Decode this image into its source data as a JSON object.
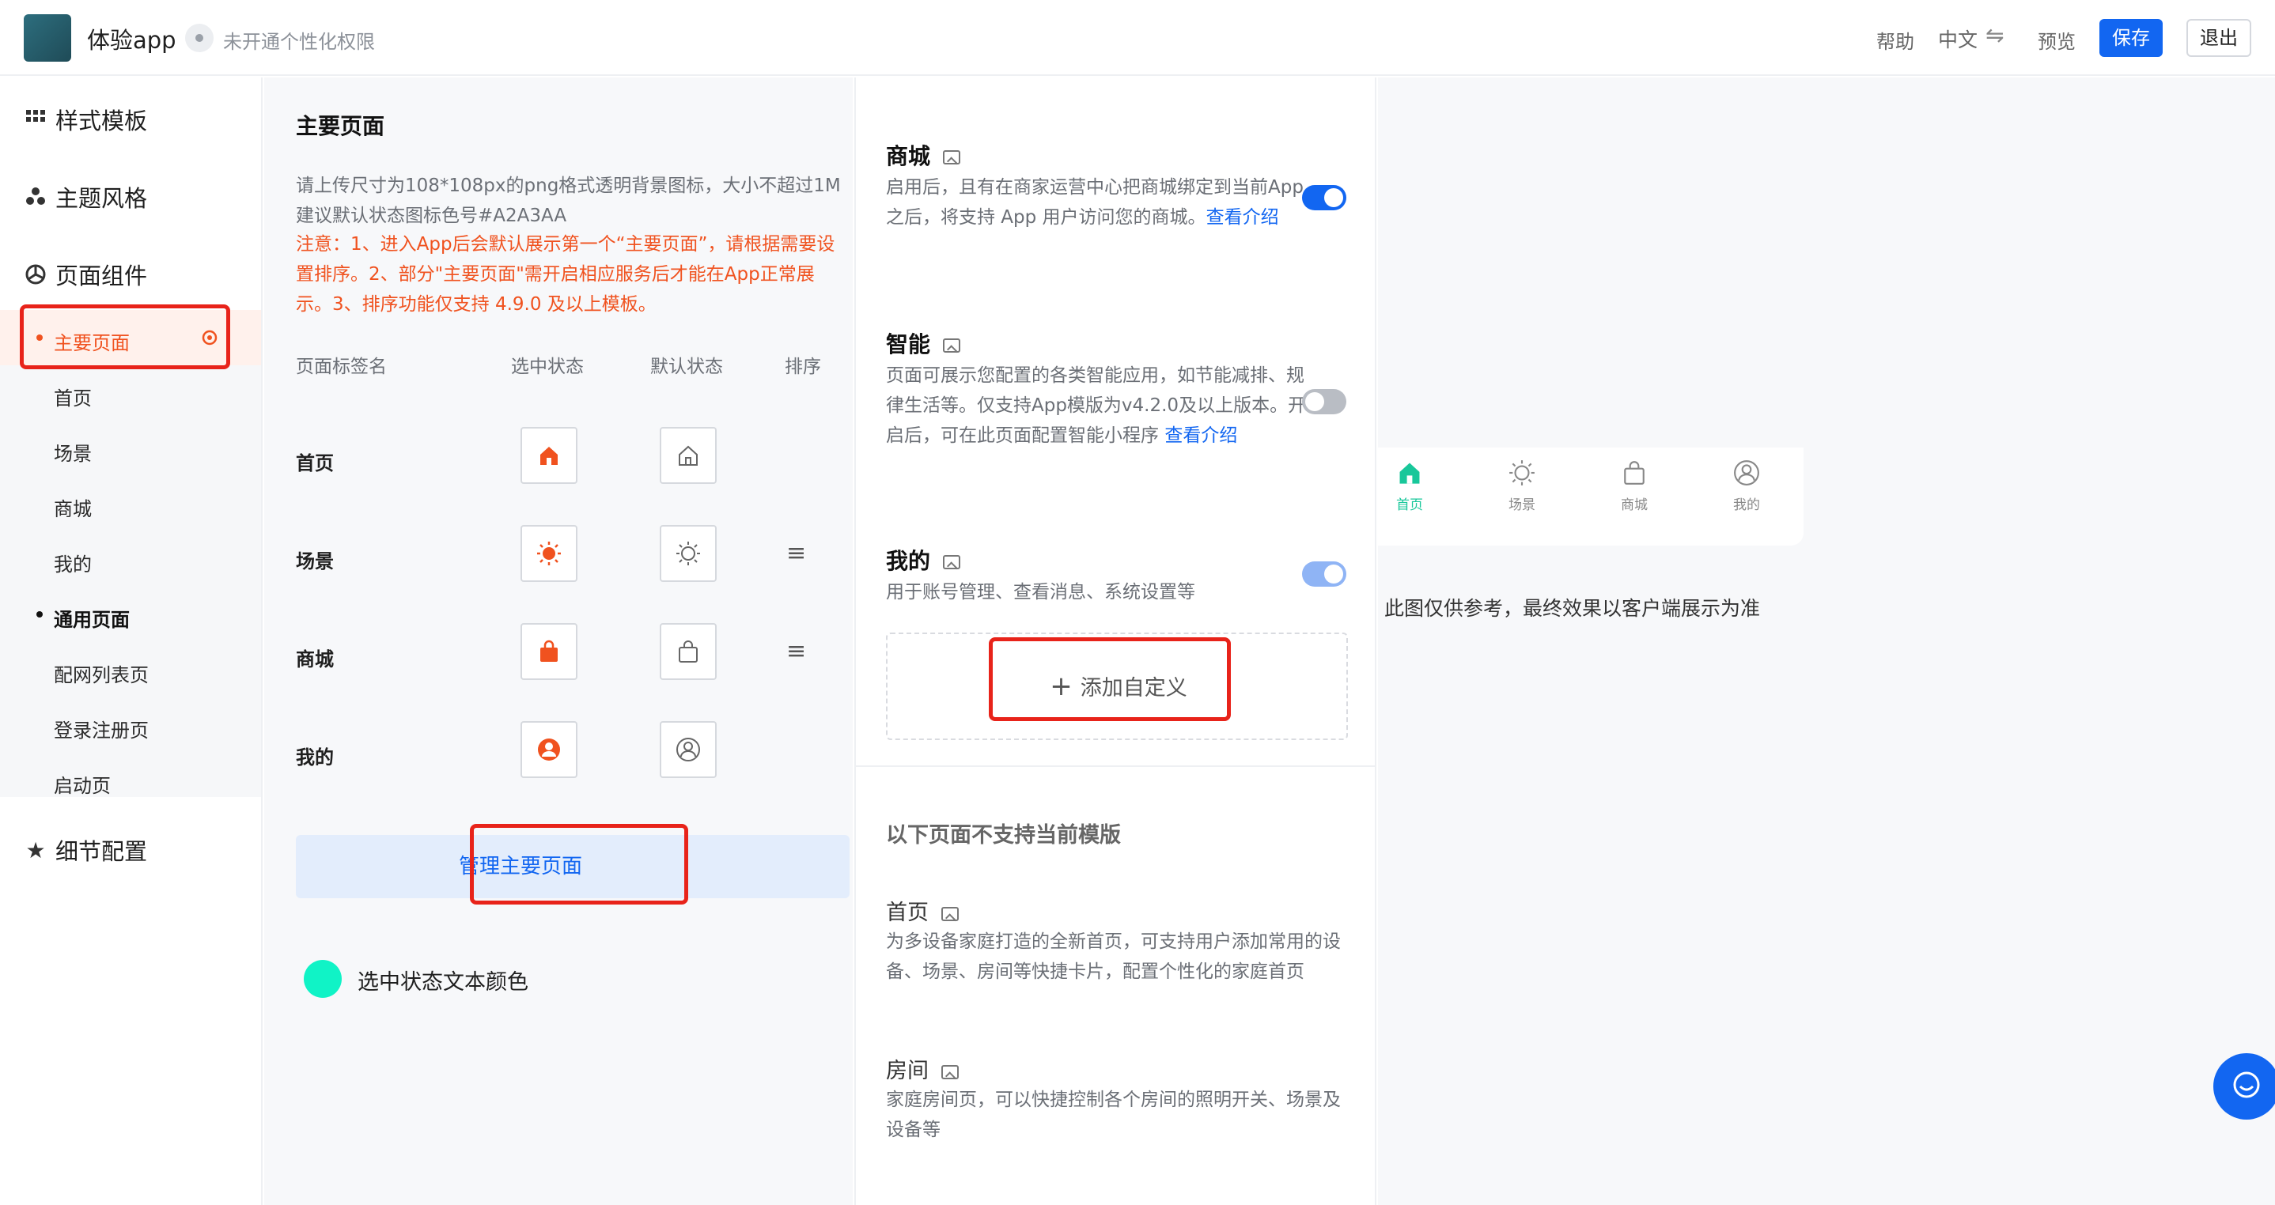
{
  "header": {
    "app_name": "体验app",
    "permission_status": "未开通个性化权限",
    "help": "帮助",
    "language": "中文",
    "preview": "预览",
    "save": "保存",
    "exit": "退出"
  },
  "sidebar": {
    "groups": [
      {
        "label": "样式模板",
        "icon": "grid-icon"
      },
      {
        "label": "主题风格",
        "icon": "palette-icon"
      },
      {
        "label": "页面组件",
        "icon": "component-icon"
      },
      {
        "label": "细节配置",
        "icon": "star-icon"
      }
    ],
    "items": [
      "主要页面",
      "首页",
      "场景",
      "商城",
      "我的",
      "通用页面",
      "配网列表页",
      "登录注册页",
      "启动页"
    ]
  },
  "main": {
    "title": "主要页面",
    "description": "请上传尺寸为108*108px的png格式透明背景图标，大小不超过1M 建议默认状态图标色号#A2A3AA",
    "warning": "注意：1、进入App后会默认展示第一个“主要页面”，请根据需要设置排序。2、部分\"主要页面\"需开启相应服务后才能在App正常展示。3、排序功能仅支持 4.9.0 及以上模板。",
    "columns": [
      "页面标签名",
      "选中状态",
      "默认状态",
      "排序"
    ],
    "rows": [
      "首页",
      "场景",
      "商城",
      "我的"
    ],
    "manage_button": "管理主要页面",
    "selected_color_label": "选中状态文本颜色",
    "selected_color": "#10f3c6"
  },
  "components": {
    "mall": {
      "title": "商城",
      "desc": "启用后，且有在商家运营中心把商城绑定到当前App 之后，将支持 App 用户访问您的商城。",
      "link": "查看介绍",
      "enabled": true
    },
    "smart": {
      "title": "智能",
      "desc": "页面可展示您配置的各类智能应用，如节能减排、规律生活等。仅支持App模版为v4.2.0及以上版本。开启后，可在此页面配置智能小程序",
      "link": "查看介绍",
      "enabled": false
    },
    "mine": {
      "title": "我的",
      "desc": "用于账号管理、查看消息、系统设置等",
      "enabled": true
    },
    "add_custom": "添加自定义",
    "unsupported_title": "以下页面不支持当前模版",
    "unsupported": [
      {
        "title": "首页",
        "desc": "为多设备家庭打造的全新首页，可支持用户添加常用的设备、场景、房间等快捷卡片，配置个性化的家庭首页"
      },
      {
        "title": "房间",
        "desc": "家庭房间页，可以快捷控制各个房间的照明开关、场景及设备等"
      }
    ]
  },
  "preview": {
    "tabs": [
      "首页",
      "场景",
      "商城",
      "我的"
    ],
    "note": "此图仅供参考，最终效果以客户端展示为准"
  },
  "colors": {
    "accent": "#1266f1",
    "warning": "#f0521f",
    "selected": "#18c79a",
    "highlight": "#e8231a"
  }
}
